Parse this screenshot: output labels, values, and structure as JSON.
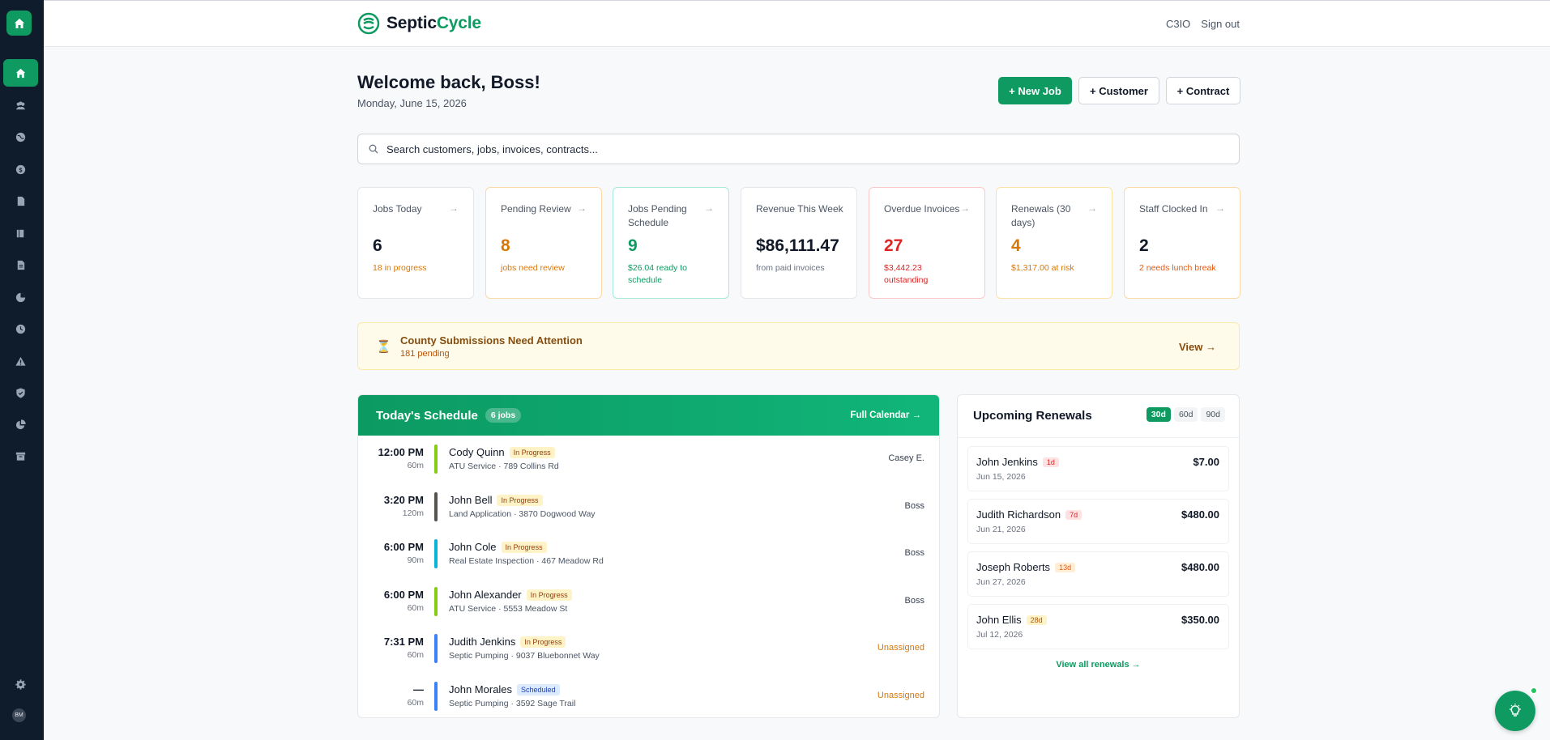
{
  "brand": {
    "part1": "Septic",
    "part2": "Cycle"
  },
  "topbar": {
    "link_user": "C3IO",
    "link_signout": "Sign out"
  },
  "header": {
    "welcome": "Welcome back, Boss!",
    "date": "Monday, June 15, 2026",
    "btn_new_job": "+ New Job",
    "btn_customer": "+ Customer",
    "btn_contract": "+ Contract"
  },
  "search": {
    "placeholder": "Search customers, jobs, invoices, contracts..."
  },
  "stats": [
    {
      "label": "Jobs Today",
      "value": "6",
      "sub": "18 in progress",
      "value_color": "#111827",
      "sub_color": "#d97706"
    },
    {
      "label": "Pending Review",
      "value": "8",
      "sub": "jobs need review",
      "value_color": "#d97706",
      "sub_color": "#d97706"
    },
    {
      "label": "Jobs Pending Schedule",
      "value": "9",
      "sub": "$26.04 ready to schedule",
      "value_color": "#0e9a61",
      "sub_color": "#0e9a61"
    },
    {
      "label": "Revenue This Week",
      "value": "$86,111.47",
      "sub": "from paid invoices",
      "value_color": "#111827",
      "sub_color": "#6b7280"
    },
    {
      "label": "Overdue Invoices",
      "value": "27",
      "sub": "$3,442.23 outstanding",
      "value_color": "#dc2626",
      "sub_color": "#dc2626"
    },
    {
      "label": "Renewals (30 days)",
      "value": "4",
      "sub": "$1,317.00 at risk",
      "value_color": "#d97706",
      "sub_color": "#d97706"
    },
    {
      "label": "Staff Clocked In",
      "value": "2",
      "sub": "2 needs lunch break",
      "value_color": "#111827",
      "sub_color": "#ea580c"
    }
  ],
  "banner": {
    "title": "County Submissions Need Attention",
    "subtitle": "181 pending",
    "action": "View →"
  },
  "schedule": {
    "title": "Today's Schedule",
    "count": "6 jobs",
    "link": "Full Calendar →",
    "jobs": [
      {
        "time": "12:00 PM",
        "duration": "60m",
        "name": "Cody Quinn",
        "status": "In Progress",
        "desc": "ATU Service · 789 Collins Rd",
        "assignee": "Casey E.",
        "color": "#84cc16"
      },
      {
        "time": "3:20 PM",
        "duration": "120m",
        "name": "John Bell",
        "status": "In Progress",
        "desc": "Land Application · 3870 Dogwood Way",
        "assignee": "Boss",
        "color": "#57534e"
      },
      {
        "time": "6:00 PM",
        "duration": "90m",
        "name": "John Cole",
        "status": "In Progress",
        "desc": "Real Estate Inspection · 467 Meadow Rd",
        "assignee": "Boss",
        "color": "#06b6d4"
      },
      {
        "time": "6:00 PM",
        "duration": "60m",
        "name": "John Alexander",
        "status": "In Progress",
        "desc": "ATU Service · 5553 Meadow St",
        "assignee": "Boss",
        "color": "#84cc16"
      },
      {
        "time": "7:31 PM",
        "duration": "60m",
        "name": "Judith Jenkins",
        "status": "In Progress",
        "desc": "Septic Pumping · 9037 Bluebonnet Way",
        "assignee": "Unassigned",
        "color": "#3b82f6"
      },
      {
        "time": "—",
        "duration": "60m",
        "name": "John Morales",
        "status": "Scheduled",
        "desc": "Septic Pumping · 3592 Sage Trail",
        "assignee": "Unassigned",
        "color": "#3b82f6"
      }
    ]
  },
  "renewals": {
    "title": "Upcoming Renewals",
    "tabs": [
      "30d",
      "60d",
      "90d"
    ],
    "items": [
      {
        "name": "John Jenkins",
        "days": "1d",
        "date": "Jun 15, 2026",
        "amount": "$7.00",
        "tone": "red"
      },
      {
        "name": "Judith Richardson",
        "days": "7d",
        "date": "Jun 21, 2026",
        "amount": "$480.00",
        "tone": "red"
      },
      {
        "name": "Joseph Roberts",
        "days": "13d",
        "date": "Jun 27, 2026",
        "amount": "$480.00",
        "tone": "orange"
      },
      {
        "name": "John Ellis",
        "days": "28d",
        "date": "Jul 12, 2026",
        "amount": "$350.00",
        "tone": "amber"
      }
    ],
    "view_all": "View all renewals →"
  },
  "sidebar": {
    "items": [
      "home-icon",
      "team-icon",
      "globe-icon",
      "billing-icon",
      "document-icon",
      "book-icon",
      "report-icon",
      "map-icon",
      "clock-icon",
      "alert-icon",
      "shield-icon",
      "pie-icon",
      "archive-icon"
    ],
    "settings_icon": "gear-icon",
    "avatar": "BM"
  },
  "colors": {
    "accent": "#0e9a61",
    "sidebar_bg": "#0f1c2b"
  }
}
